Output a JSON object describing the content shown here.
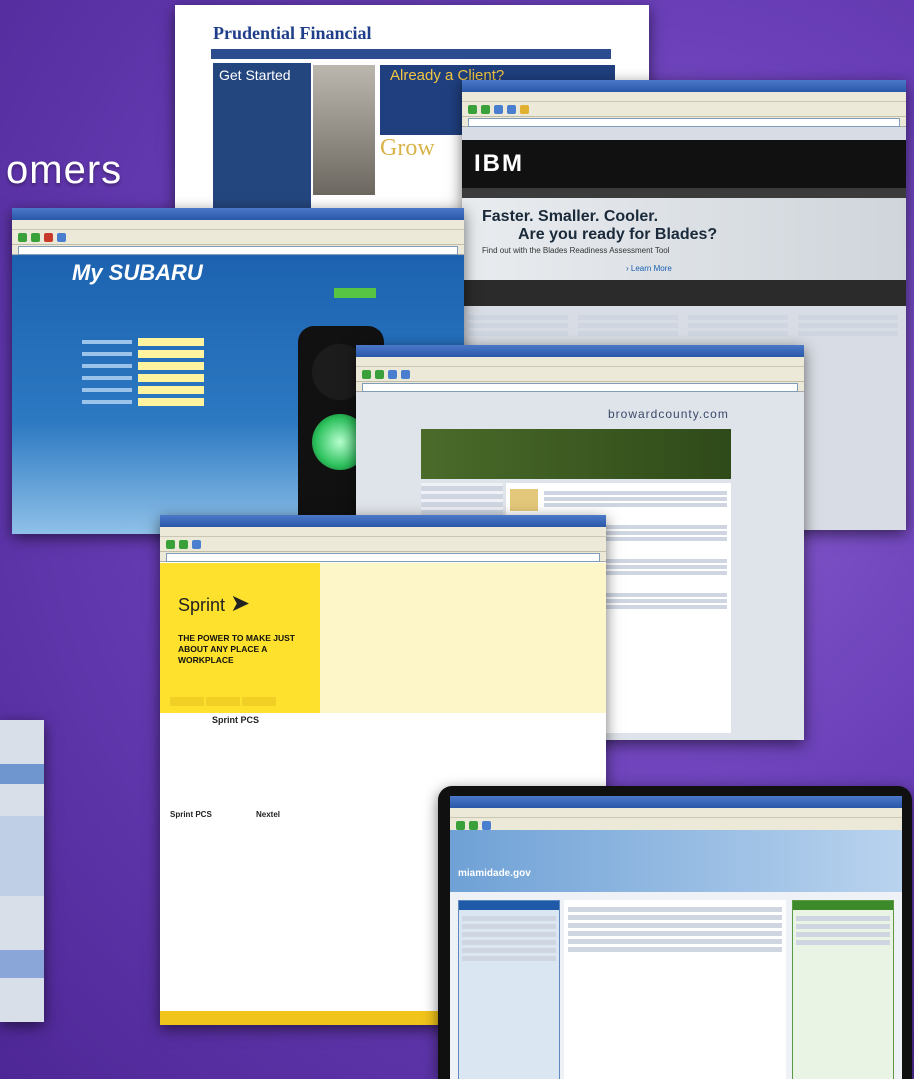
{
  "slide": {
    "title_fragment": "omers"
  },
  "colors": {
    "slide_background": "#6a3fb8",
    "ie_titlebar": "#2a57a8"
  },
  "screenshots": {
    "prudential": {
      "logo": "Prudential Financial",
      "get_started": "Get Started",
      "already_client": "Already a Client?",
      "grow": "Grow"
    },
    "ibm": {
      "logo": "IBM",
      "headline_1": "Faster. Smaller. Cooler.",
      "headline_2": "Are you ready for Blades?",
      "subline": "Find out with the Blades Readiness Assessment Tool",
      "learn_more": "› Learn More"
    },
    "subaru": {
      "logo": "My SUBARU"
    },
    "broward": {
      "site_url": "browardcounty.com"
    },
    "sprint": {
      "logo": "Sprint",
      "tagline": "THE POWER TO MAKE JUST ABOUT ANY PLACE A WORKPLACE",
      "product_1": "Sprint PCS",
      "column_1": "Sprint PCS",
      "column_2": "Nextel"
    },
    "miamidade": {
      "logo": "miamidade.gov"
    }
  }
}
